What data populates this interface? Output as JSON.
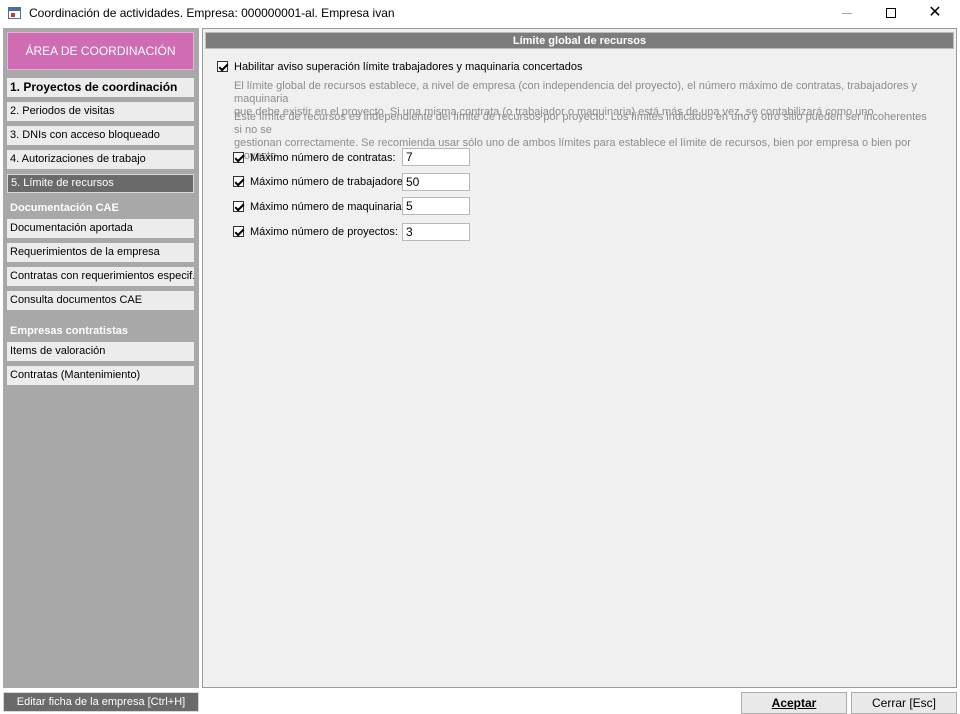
{
  "window": {
    "title": "Coordinación de actividades. Empresa: 000000001-al. Empresa ivan",
    "minimize_icon": "minimize-icon",
    "maximize_icon": "maximize-icon",
    "close_icon": "close-icon"
  },
  "sidebar": {
    "area_button": "ÁREA DE COORDINACIÓN",
    "group1": [
      {
        "label": "1. Proyectos de coordinación",
        "style": "bold"
      },
      {
        "label": "2. Periodos de visitas",
        "style": "normal"
      },
      {
        "label": "3. DNIs con acceso bloqueado",
        "style": "normal"
      },
      {
        "label": "4. Autorizaciones de trabajo",
        "style": "normal"
      },
      {
        "label": "5. Límite de recursos",
        "style": "selected"
      }
    ],
    "heading_cae": "Documentación CAE",
    "group2": [
      {
        "label": "Documentación aportada"
      },
      {
        "label": "Requerimientos de la empresa"
      },
      {
        "label": "Contratas con requerimientos especif."
      },
      {
        "label": "Consulta documentos CAE"
      }
    ],
    "heading_contratistas": "Empresas contratistas",
    "group3": [
      {
        "label": "Items de valoración"
      },
      {
        "label": "Contratas (Mantenimiento)"
      }
    ],
    "edit_button": "Editar ficha de la empresa [Ctrl+H]"
  },
  "main": {
    "section_title": "Límite global de recursos",
    "enable_label": "Habilitar aviso superación límite trabajadores y maquinaria concertados",
    "enable_checked": true,
    "desc1_line1": "El límite global de recursos establece, a nivel de empresa (con independencia del proyecto), el número máximo de contratas, trabajadores y maquinaria",
    "desc1_line2": "que debe existir en el proyecto. Si una misma contrata (o trabajador o maquinaria) está más de una vez, se contabilizará como uno",
    "desc2_line1": "Este límite de recursos es independiente del límite de recursos por proyecto. Los límites indicados en uno y otro sitio pueden ser incoherentes si no se",
    "desc2_line2": "gestionan correctamente. Se recomienda usar sólo uno de ambos límites para establece el límite de recursos, bien por empresa o bien por proyecto",
    "limits": [
      {
        "label": "Máximo número de contratas:",
        "value": "7",
        "checked": true
      },
      {
        "label": "Máximo número de trabajadores:",
        "value": "50",
        "checked": true
      },
      {
        "label": "Máximo número de maquinaria:",
        "value": "5",
        "checked": true
      },
      {
        "label": "Máximo número de proyectos:",
        "value": "3",
        "checked": true
      }
    ]
  },
  "footer": {
    "accept_label": "Aceptar",
    "close_label": "Cerrar  [Esc]"
  },
  "colors": {
    "area_button": "#d06cb4",
    "sidebar_bg": "#a8a8a8",
    "selected_item": "#6a6a6a",
    "section_header": "#7c7c7c"
  }
}
